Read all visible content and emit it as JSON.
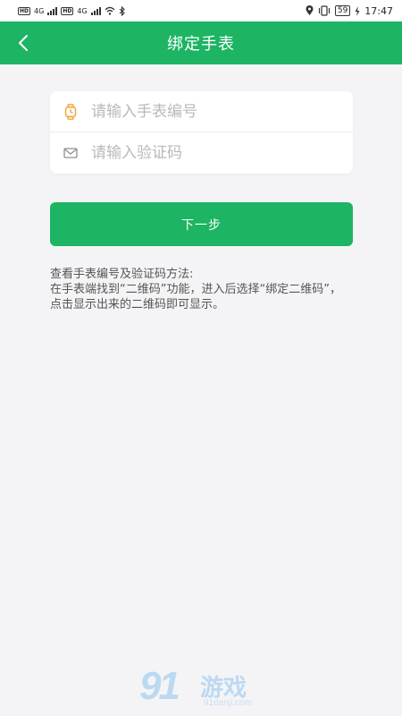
{
  "status_bar": {
    "network_1": "4G",
    "network_2": "4G",
    "battery": "59",
    "time": "17:47"
  },
  "header": {
    "title": "绑定手表"
  },
  "form": {
    "watch_number_placeholder": "请输入手表编号",
    "verification_code_placeholder": "请输入验证码",
    "watch_number_value": "",
    "verification_code_value": ""
  },
  "next_button": {
    "label": "下一步"
  },
  "help": {
    "title": "查看手表编号及验证码方法:",
    "body": "在手表端找到“二维码”功能，进入后选择“绑定二维码”，点击显示出来的二维码即可显示。"
  },
  "watermark": {
    "logo_number": "91",
    "logo_text": "游戏",
    "url": "91danji.com"
  },
  "icons": {
    "back": "chevron-left-icon",
    "watch": "watch-icon",
    "mail": "envelope-icon"
  },
  "colors": {
    "primary": "#1db463",
    "watch_icon": "#f0a53a"
  }
}
